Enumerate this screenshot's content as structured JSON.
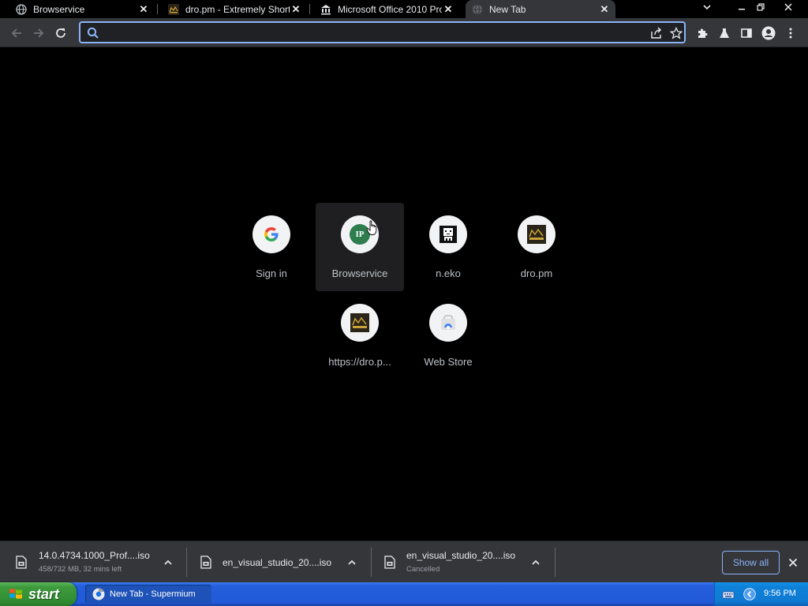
{
  "tabs": [
    {
      "title": "Browservice",
      "favicon": "globe-icon",
      "active": false
    },
    {
      "title": "dro.pm - Extremely Short",
      "favicon": "dro-pm-favicon",
      "active": false
    },
    {
      "title": "Microsoft Office 2010 Pro",
      "favicon": "bank-icon",
      "active": false
    },
    {
      "title": "New Tab",
      "favicon": "globe-icon",
      "active": true
    }
  ],
  "omnibox": {
    "value": "",
    "placeholder": ""
  },
  "shortcuts": [
    {
      "label": "Sign in",
      "icon": "google-icon"
    },
    {
      "label": "Browservice",
      "icon": "ip-badge-icon",
      "badge": "IP"
    },
    {
      "label": "n.eko",
      "icon": "neko-icon"
    },
    {
      "label": "dro.pm",
      "icon": "dro-pm-icon"
    },
    {
      "label": "https://dro.p...",
      "icon": "dro-pm-icon"
    },
    {
      "label": "Web Store",
      "icon": "web-store-icon"
    }
  ],
  "downloads": [
    {
      "name": "14.0.4734.1000_Prof....iso",
      "status": "458/732 MB, 32 mins left"
    },
    {
      "name": "en_visual_studio_20....iso",
      "status": ""
    },
    {
      "name": "en_visual_studio_20....iso",
      "status": "Cancelled"
    }
  ],
  "shelf": {
    "show_all_label": "Show all"
  },
  "taskbar": {
    "start_label": "start",
    "task_label": "New Tab - Supermium",
    "clock": "9:56 PM"
  },
  "colors": {
    "accent": "#8ab4f8",
    "toolbar_bg": "#35363a",
    "page_bg": "#000000",
    "xp_blue": "#245edb",
    "xp_green": "#3c9a3c"
  }
}
